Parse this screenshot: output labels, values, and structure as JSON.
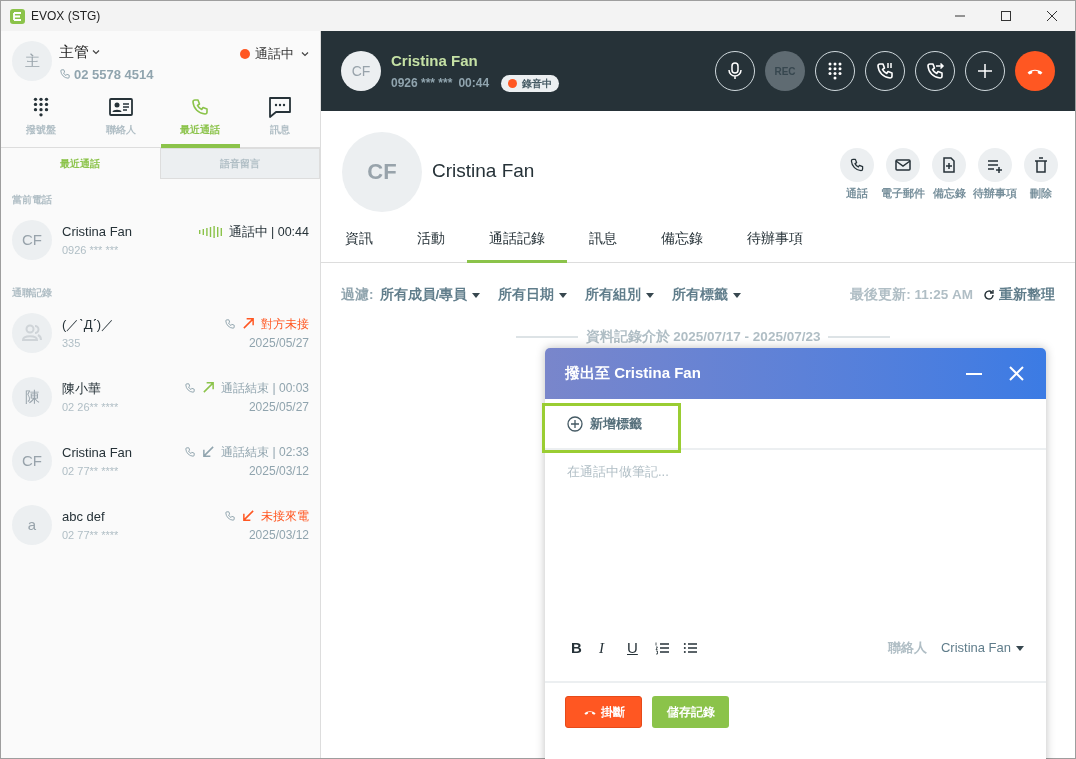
{
  "window": {
    "title": "EVOX (STG)"
  },
  "user": {
    "avatar": "主",
    "name": "主管",
    "phone": "02 5578 4514",
    "status": "通話中"
  },
  "nav_tabs": [
    {
      "label": "撥號盤",
      "kind": "dialpad",
      "selected": false
    },
    {
      "label": "聯絡人",
      "kind": "contacts",
      "selected": false
    },
    {
      "label": "最近通話",
      "kind": "phone",
      "selected": true
    },
    {
      "label": "訊息",
      "kind": "chat",
      "selected": false
    }
  ],
  "sub_tabs": [
    {
      "label": "最近通話",
      "selected": true
    },
    {
      "label": "語音留言",
      "selected": false
    }
  ],
  "current_section": "當前電話",
  "current_call": {
    "avatar": "CF",
    "name": "Cristina Fan",
    "number": "0926 *** ***",
    "status": "通話中 | 00:44"
  },
  "history_section": "通聯記錄",
  "history": [
    {
      "name": "(／ˋДˊ)／",
      "number": "335",
      "kind": "outgoing",
      "missed": true,
      "status": "對方未接",
      "date": "2025/05/27"
    },
    {
      "avatar": "陳",
      "name": "陳小華",
      "number": "02 26** ****",
      "kind": "outgoing",
      "missed": false,
      "status": "通話結束 | 00:03",
      "date": "2025/05/27"
    },
    {
      "avatar": "CF",
      "name": "Cristina Fan",
      "number": "02 77** ****",
      "kind": "incoming",
      "missed": false,
      "status": "通話結束 | 02:33",
      "date": "2025/03/12"
    },
    {
      "avatar": "a",
      "name": "abc def",
      "number": "02 77** ****",
      "kind": "incoming",
      "missed": true,
      "status": "未接來電",
      "date": "2025/03/12"
    }
  ],
  "call_bar": {
    "avatar": "CF",
    "name": "Cristina Fan",
    "number": "0926 *** ***",
    "duration": "00:44",
    "recording": "錄音中",
    "controls": [
      {
        "kind": "mic"
      },
      {
        "kind": "rec",
        "label": "REC"
      },
      {
        "kind": "dialpad"
      },
      {
        "kind": "hold"
      },
      {
        "kind": "transfer"
      },
      {
        "kind": "add"
      },
      {
        "kind": "hangup"
      }
    ]
  },
  "contact": {
    "avatar": "CF",
    "name": "Cristina Fan",
    "actions": [
      {
        "kind": "phone",
        "label": "通話"
      },
      {
        "kind": "mail",
        "label": "電子郵件"
      },
      {
        "kind": "note",
        "label": "備忘錄"
      },
      {
        "kind": "todo",
        "label": "待辦事項"
      },
      {
        "kind": "delete",
        "label": "刪除"
      }
    ]
  },
  "tabs": [
    {
      "label": "資訊",
      "selected": false
    },
    {
      "label": "活動",
      "selected": false
    },
    {
      "label": "通話記錄",
      "selected": true
    },
    {
      "label": "訊息",
      "selected": false
    },
    {
      "label": "備忘錄",
      "selected": false
    },
    {
      "label": "待辦事項",
      "selected": false
    }
  ],
  "filter": {
    "label": "過濾:",
    "options": [
      "所有成員/專員",
      "所有日期",
      "所有組別",
      "所有標籤"
    ],
    "updated": "最後更新: 11:25 AM",
    "refresh": "重新整理"
  },
  "range": "資料記錄介於 2025/07/17 - 2025/07/23",
  "dialog": {
    "title": "撥出至 Cristina Fan",
    "add_tag": "新增標籤",
    "placeholder": "在通話中做筆記...",
    "format_buttons": [
      {
        "kind": "bold",
        "label": "B"
      },
      {
        "kind": "italic",
        "label": "I"
      },
      {
        "kind": "underline",
        "label": "U"
      },
      {
        "kind": "ol"
      },
      {
        "kind": "ul"
      }
    ],
    "contact_label": "聯絡人",
    "contact_value": "Cristina Fan",
    "hangup": "掛斷",
    "save": "儲存記錄"
  }
}
